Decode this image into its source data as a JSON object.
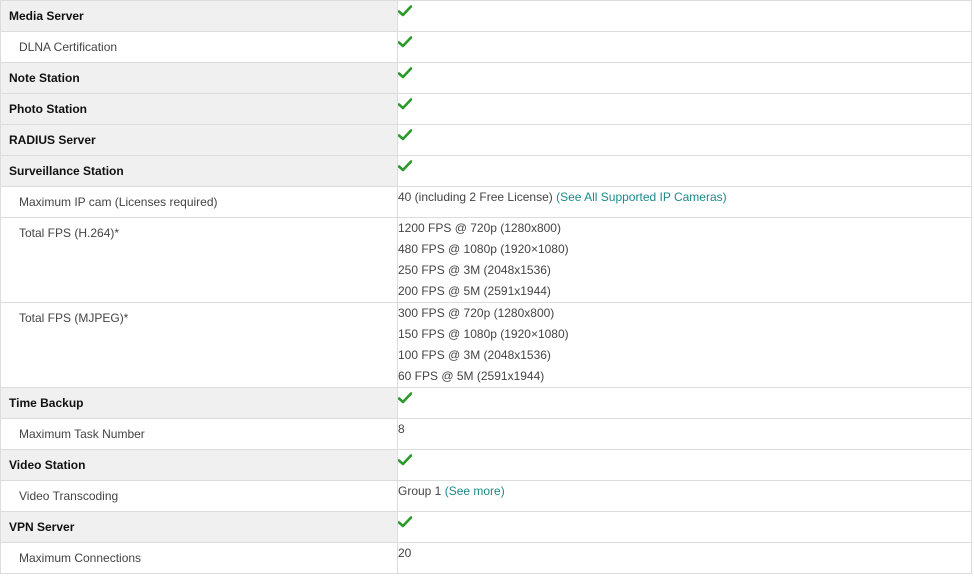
{
  "colors": {
    "check": "#2a9a2a",
    "link": "#1a8a8a",
    "section_bg": "#f0f0f0",
    "border": "#dcdcdc"
  },
  "rows": {
    "media_server": {
      "label": "Media Server",
      "check": true
    },
    "dlna": {
      "label": "DLNA Certification",
      "check": true
    },
    "note_station": {
      "label": "Note Station",
      "check": true
    },
    "photo_station": {
      "label": "Photo Station",
      "check": true
    },
    "radius_server": {
      "label": "RADIUS Server",
      "check": true
    },
    "surveillance_station": {
      "label": "Surveillance Station",
      "check": true
    },
    "max_ip_cam": {
      "label": "Maximum IP cam (Licenses required)",
      "value": "40 (including 2 Free License) ",
      "link": "(See All Supported IP Cameras)"
    },
    "fps_h264": {
      "label": "Total FPS (H.264)*",
      "lines": [
        "1200 FPS @ 720p (1280x800)",
        "480 FPS @ 1080p (1920×1080)",
        "250 FPS @ 3M (2048x1536)",
        "200 FPS @ 5M (2591x1944)"
      ]
    },
    "fps_mjpeg": {
      "label": "Total FPS (MJPEG)*",
      "lines": [
        "300 FPS @ 720p (1280x800)",
        "150 FPS @ 1080p (1920×1080)",
        "100 FPS @ 3M (2048x1536)",
        "60 FPS @ 5M (2591x1944)"
      ]
    },
    "time_backup": {
      "label": "Time Backup",
      "check": true
    },
    "max_task": {
      "label": "Maximum Task Number",
      "value": "8"
    },
    "video_station": {
      "label": "Video Station",
      "check": true
    },
    "video_transcoding": {
      "label": "Video Transcoding",
      "value": "Group 1 ",
      "link": "(See more)"
    },
    "vpn_server": {
      "label": "VPN Server",
      "check": true
    },
    "max_connections": {
      "label": "Maximum Connections",
      "value": "20"
    }
  }
}
